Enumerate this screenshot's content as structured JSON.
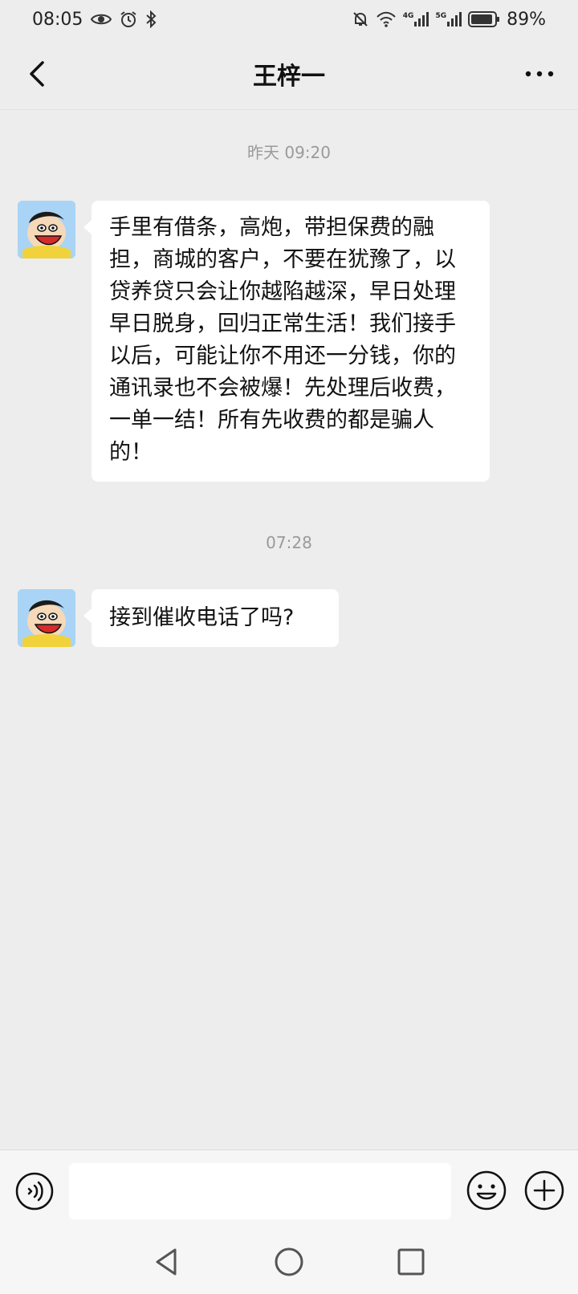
{
  "status": {
    "time": "08:05",
    "network_4g": "4G",
    "network_5g": "5G",
    "battery": "89%"
  },
  "header": {
    "title": "王梓一"
  },
  "messages": [
    {
      "timestamp": "昨天 09:20",
      "sender": "received",
      "text": " 手里有借条，高炮，带担保费的融担，商城的客户，不要在犹豫了，以贷养贷只会让你越陷越深，早日处理早日脱身，回归正常生活！我们接手以后，可能让你不用还一分钱，你的通讯录也不会被爆！先处理后收费，一单一结！所有先收费的都是骗人的！"
    },
    {
      "timestamp": "07:28",
      "sender": "received",
      "text": "接到催收电话了吗?"
    }
  ],
  "input": {
    "value": "",
    "placeholder": ""
  },
  "icons": {
    "back": "chevron-left-icon",
    "more": "more-horizontal-icon",
    "voice": "voice-icon",
    "emoji": "emoji-icon",
    "plus": "plus-icon"
  }
}
